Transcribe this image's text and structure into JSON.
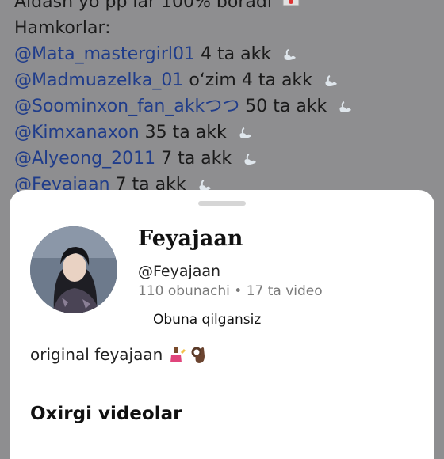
{
  "background_post": {
    "line1": "Aldash yo pp lar 100% boradi",
    "line2": "Hamkorlar:",
    "partners": [
      {
        "mention": "@Mata_mastergirl01",
        "text": "4 ta akk"
      },
      {
        "mention": "@Madmuazelka_01",
        "text": "o‘zim 4 ta akk"
      },
      {
        "mention": "@Soominxon_fan_akkつつ",
        "text": "50 ta akk"
      },
      {
        "mention": "@Kimxanaxon",
        "text": "35 ta akk"
      },
      {
        "mention": "@Alyeong_2011",
        "text": "7 ta akk"
      },
      {
        "mention": "@Feyajaan",
        "text": "7 ta akk"
      }
    ]
  },
  "profile": {
    "name": "Feyajaan",
    "username": "@Feyajaan",
    "stats": "110 obunachi • 17 ta video",
    "follow_status": "Obuna qilgansiz",
    "bio": "original feyajaan"
  },
  "recent_videos": {
    "title": "Oxirgi videolar"
  },
  "colors": {
    "mention": "#1f3c8a",
    "sheet": "#ffffff",
    "dim_overlay": "#8e8e90"
  }
}
